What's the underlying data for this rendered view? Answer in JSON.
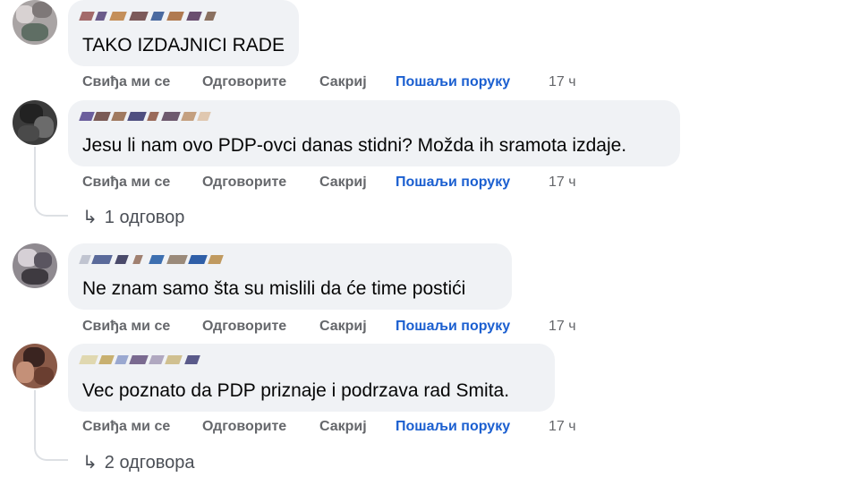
{
  "actions": {
    "like": "Свиђа ми се",
    "reply": "Одговорите",
    "hide": "Сакриј",
    "message": "Пошаљи поруку"
  },
  "comments": [
    {
      "text": "TAKO IZDAJNICI RADE",
      "time": "17 ч"
    },
    {
      "text": "Jesu li nam ovo PDP-ovci danas stidni? Možda ih sramota izdaje.",
      "time": "17 ч",
      "replies": "1 одговор"
    },
    {
      "text": "Ne znam samo šta su mislili da će time postići",
      "time": "17 ч"
    },
    {
      "text": "Vec poznato da PDP priznaje i podrzava rad Smita.",
      "time": "17 ч",
      "replies": "2 одговора"
    }
  ],
  "icons": {
    "reply_arrow": "reply-arrow-icon"
  },
  "colors": {
    "bubble": "#f0f2f5",
    "link": "#1b5fd0",
    "meta": "#65676b"
  }
}
